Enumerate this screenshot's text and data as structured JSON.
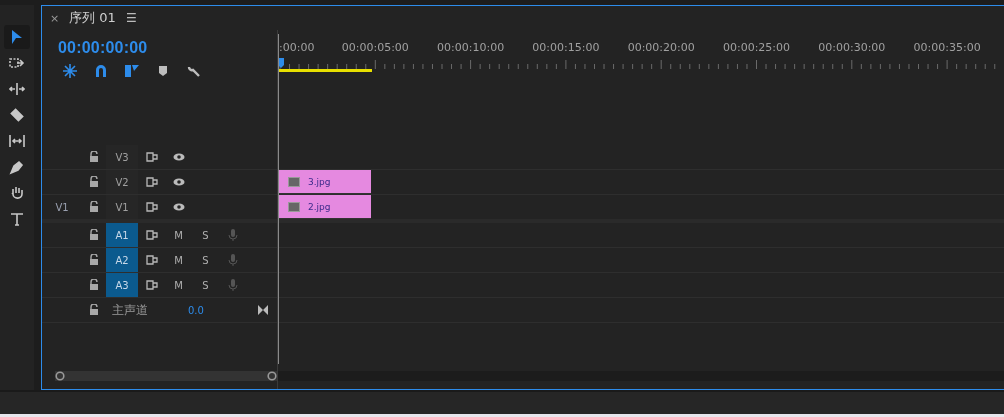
{
  "tools": [
    {
      "kind": "selection",
      "selected": true
    },
    {
      "kind": "track-select",
      "selected": false
    },
    {
      "kind": "ripple",
      "selected": false
    },
    {
      "kind": "razor",
      "selected": false
    },
    {
      "kind": "slip",
      "selected": false
    },
    {
      "kind": "pen",
      "selected": false
    },
    {
      "kind": "hand",
      "selected": false
    },
    {
      "kind": "type",
      "selected": false
    }
  ],
  "sequence_tab": {
    "close": "×",
    "title": "序列 01",
    "menu": "☰"
  },
  "timecode": "00:00:00:00",
  "timeline_toolbar": [
    {
      "kind": "nest",
      "on": true
    },
    {
      "kind": "snap",
      "on": true
    },
    {
      "kind": "linked",
      "on": true
    },
    {
      "kind": "marker",
      "on": false
    },
    {
      "kind": "settings",
      "on": false
    }
  ],
  "ruler": {
    "labels": [
      ":00:00",
      "00:00:05:00",
      "00:00:10:00",
      "00:00:15:00",
      "00:00:20:00",
      "00:00:25:00",
      "00:00:30:00",
      "00:00:35:00"
    ]
  },
  "tracks": [
    {
      "kind": "video",
      "name": "V3",
      "targeted": false
    },
    {
      "kind": "video",
      "name": "V2",
      "targeted": false,
      "clip": "3.jpg"
    },
    {
      "kind": "video",
      "name": "V1",
      "source_patch": "V1",
      "targeted": false,
      "clip": "2.jpg"
    },
    {
      "kind": "audio",
      "name": "A1",
      "targeted": true,
      "mute": "M",
      "solo": "S"
    },
    {
      "kind": "audio",
      "name": "A2",
      "targeted": true,
      "mute": "M",
      "solo": "S"
    },
    {
      "kind": "audio",
      "name": "A3",
      "targeted": true,
      "mute": "M",
      "solo": "S"
    }
  ],
  "master": {
    "label": "主声道",
    "volume": "0.0"
  }
}
